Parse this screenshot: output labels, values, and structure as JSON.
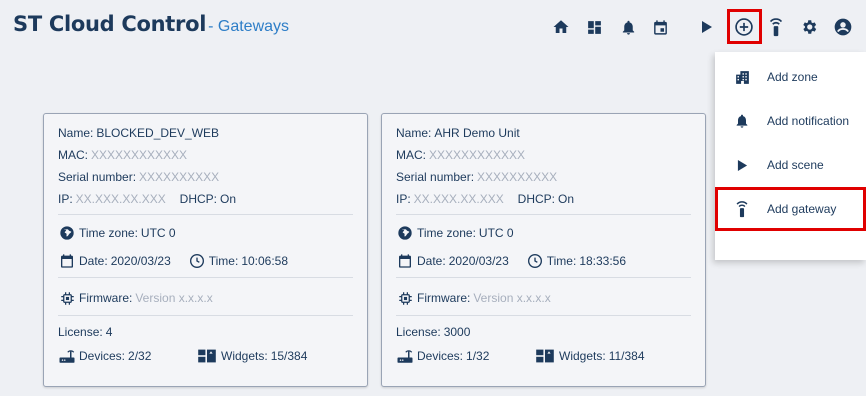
{
  "header": {
    "app_title": "ST Cloud Control",
    "section": "- Gateways",
    "icons": [
      "home-icon",
      "dashboard-icon",
      "bell-icon",
      "calendar-icon",
      "play-icon",
      "add-circle-icon",
      "gateway-icon",
      "gear-icon",
      "account-icon"
    ]
  },
  "add_menu": {
    "items": [
      {
        "label": "Add zone",
        "icon": "building-icon"
      },
      {
        "label": "Add notification",
        "icon": "bell-icon"
      },
      {
        "label": "Add scene",
        "icon": "play-icon"
      },
      {
        "label": "Add gateway",
        "icon": "gateway-icon"
      }
    ]
  },
  "gateways": [
    {
      "name_label": "Name:",
      "name": "BLOCKED_DEV_WEB",
      "mac_label": "MAC:",
      "mac": "XXXXXXXXXXXX",
      "serial_label": "Serial number:",
      "serial": "XXXXXXXXXX",
      "ip_label": "IP:",
      "ip": "XX.XXX.XX.XXX",
      "dhcp_label": "DHCP:",
      "dhcp": "On",
      "timezone_label": "Time zone:",
      "timezone": "UTC 0",
      "date_label": "Date:",
      "date": "2020/03/23",
      "time_label": "Time:",
      "time": "10:06:58",
      "firmware_label": "Firmware:",
      "firmware": "Version x.x.x.x",
      "license_label": "License:",
      "license": "4",
      "devices_label": "Devices:",
      "devices": "2/32",
      "widgets_label": "Widgets:",
      "widgets": "15/384"
    },
    {
      "name_label": "Name:",
      "name": "AHR Demo Unit",
      "mac_label": "MAC:",
      "mac": "XXXXXXXXXXXX",
      "serial_label": "Serial number:",
      "serial": "XXXXXXXXXX",
      "ip_label": "IP:",
      "ip": "XX.XXX.XX.XXX",
      "dhcp_label": "DHCP:",
      "dhcp": "On",
      "timezone_label": "Time zone:",
      "timezone": "UTC 0",
      "date_label": "Date:",
      "date": "2020/03/23",
      "time_label": "Time:",
      "time": "18:33:56",
      "firmware_label": "Firmware:",
      "firmware": "Version x.x.x.x",
      "license_label": "License:",
      "license": "3000",
      "devices_label": "Devices:",
      "devices": "1/32",
      "widgets_label": "Widgets:",
      "widgets": "11/384"
    }
  ],
  "colors": {
    "primary": "#1d3a5c",
    "accent": "#2e7ec7",
    "highlight": "#e00000",
    "muted": "#a7afbd",
    "background": "#eef0f4"
  }
}
